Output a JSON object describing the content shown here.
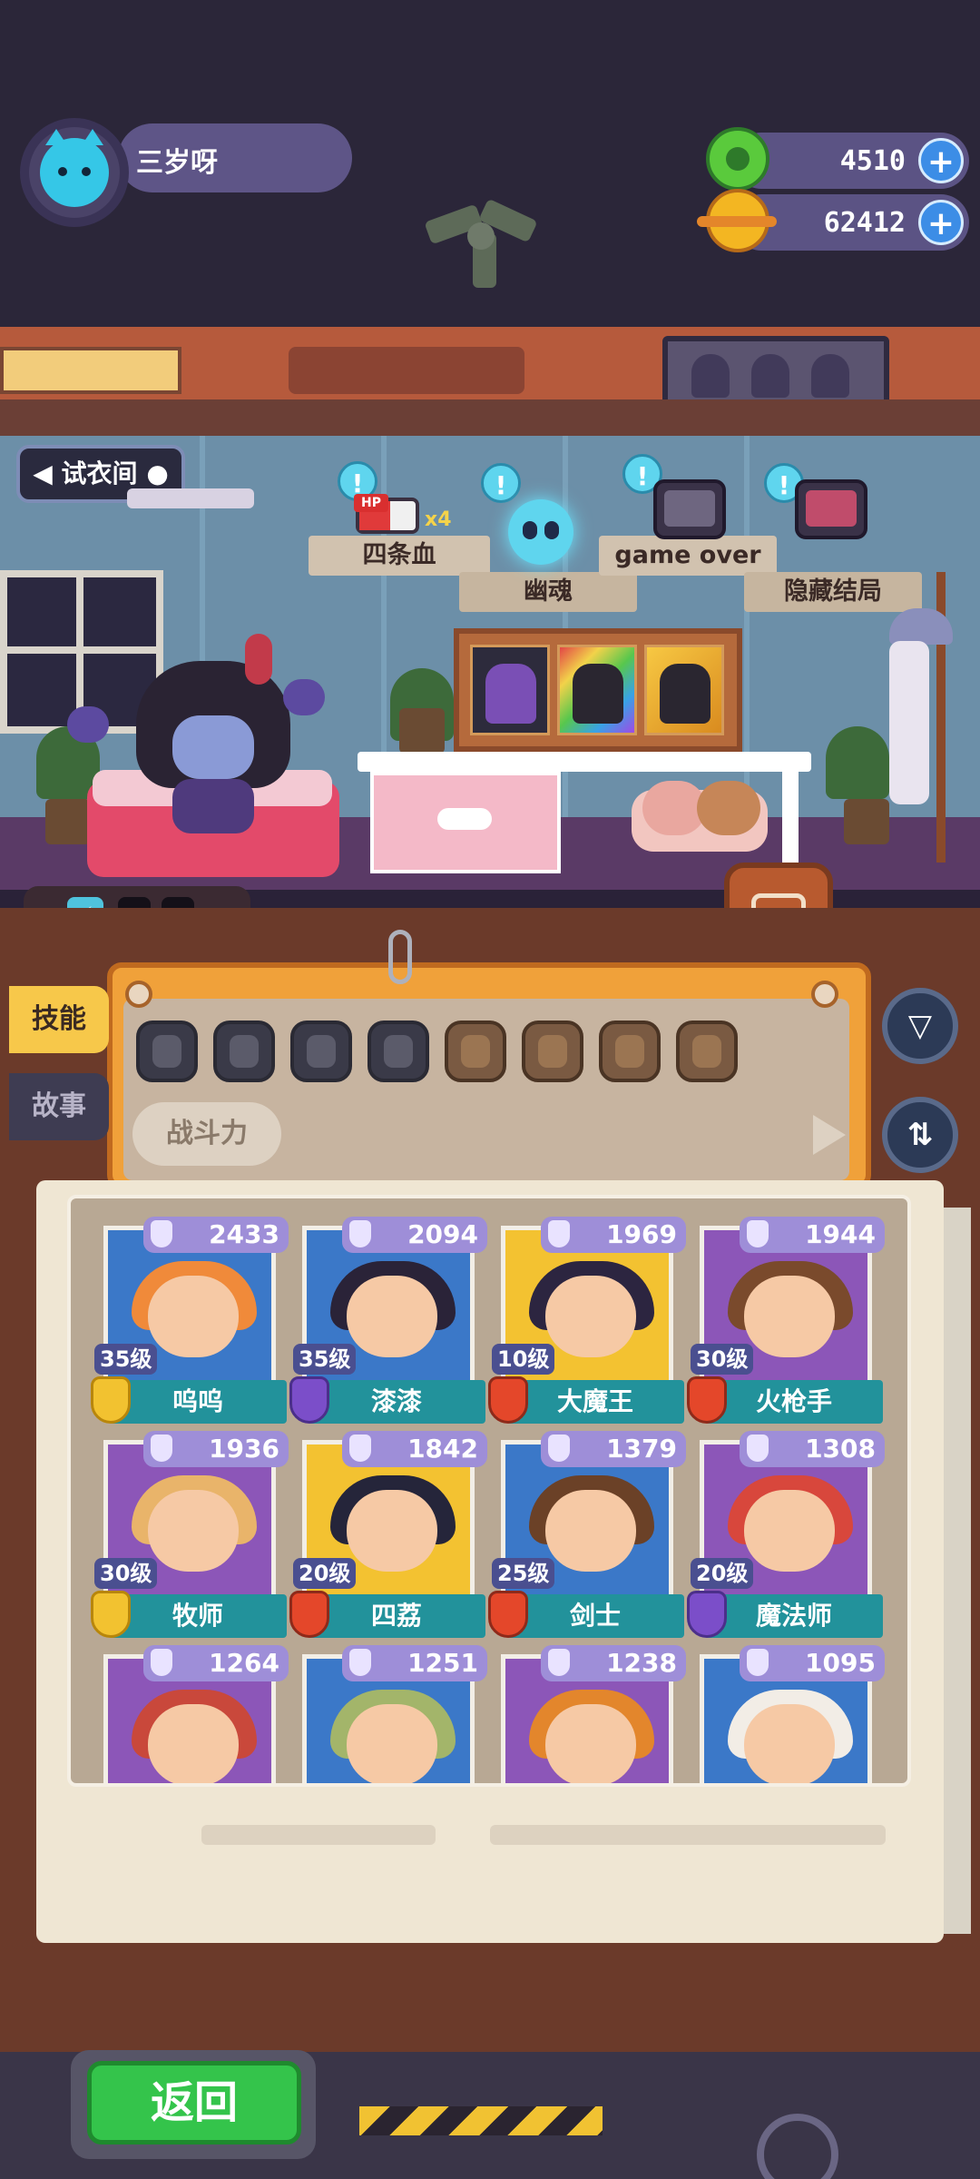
{
  "player": {
    "name": "三岁呀",
    "avatar_icon": "cat-face-icon"
  },
  "resources": [
    {
      "icon": "donut-icon",
      "value": "4510",
      "add_label": "+"
    },
    {
      "icon": "planet-icon",
      "value": "62412",
      "add_label": "+"
    }
  ],
  "room": {
    "fitting_room_label": "试衣间",
    "unlocks": [
      {
        "label": "四条血",
        "icon": "hp-battery-icon",
        "tag": "HP",
        "multiplier": "x4"
      },
      {
        "label": "幽魂",
        "icon": "ghost-skull-icon"
      },
      {
        "label": "game over",
        "icon": "tombstone-tv-icon"
      },
      {
        "label": "隐藏结局",
        "icon": "tv-icon"
      }
    ],
    "hint_label": "!"
  },
  "energy": {
    "icon": "lightning-icon",
    "bolt_label": "⚡"
  },
  "side_tabs": {
    "skills": "技能",
    "story": "故事"
  },
  "filter": {
    "sort_label": "战斗力",
    "filter_icon": "filter-funnel-icon",
    "sort_icon": "sort-arrows-icon"
  },
  "attributes": [
    {
      "icon": "heart-icon",
      "unlocked": false
    },
    {
      "icon": "bell-icon",
      "unlocked": false
    },
    {
      "icon": "shield-icon",
      "unlocked": false
    },
    {
      "icon": "anchor-icon",
      "unlocked": false
    },
    {
      "icon": "paw-icon",
      "unlocked": true
    },
    {
      "icon": "face-icon",
      "unlocked": true
    },
    {
      "icon": "muscle-icon",
      "unlocked": true
    },
    {
      "icon": "fingerprint-icon",
      "unlocked": true
    }
  ],
  "heroes": [
    {
      "power": "2433",
      "level": "35级",
      "name": "呜呜",
      "badge": "gold",
      "hair": "#f08a3a",
      "bg": "#3b78c8"
    },
    {
      "power": "2094",
      "level": "35级",
      "name": "漆漆",
      "badge": "purple",
      "hair": "#2a2338",
      "bg": "#3b78c8"
    },
    {
      "power": "1969",
      "level": "10级",
      "name": "大魔王",
      "badge": "red",
      "hair": "#2c2540",
      "bg": "#f3c231"
    },
    {
      "power": "1944",
      "level": "30级",
      "name": "火枪手",
      "badge": "red",
      "hair": "#7a4a2c",
      "bg": "#8c56b8"
    },
    {
      "power": "1936",
      "level": "30级",
      "name": "牧师",
      "badge": "gold",
      "hair": "#e9b46a",
      "bg": "#8c56b8"
    },
    {
      "power": "1842",
      "level": "20级",
      "name": "四荔",
      "badge": "red",
      "hair": "#25253a",
      "bg": "#f3c231"
    },
    {
      "power": "1379",
      "level": "25级",
      "name": "剑士",
      "badge": "red",
      "hair": "#6b4127",
      "bg": "#3b78c8"
    },
    {
      "power": "1308",
      "level": "20级",
      "name": "魔法师",
      "badge": "purple",
      "hair": "#d8473c",
      "bg": "#8c56b8"
    },
    {
      "power": "1264",
      "level": "",
      "name": "",
      "badge": "",
      "hair": "#c9483b",
      "bg": "#8c56b8"
    },
    {
      "power": "1251",
      "level": "",
      "name": "",
      "badge": "",
      "hair": "#a3b56a",
      "bg": "#3b78c8"
    },
    {
      "power": "1238",
      "level": "",
      "name": "",
      "badge": "",
      "hair": "#e3862c",
      "bg": "#8c56b8"
    },
    {
      "power": "1095",
      "level": "",
      "name": "",
      "badge": "",
      "hair": "#f2ede6",
      "bg": "#3b78c8"
    }
  ],
  "back_button": "返回",
  "colors": {
    "accent": "#f0a13a",
    "back_green": "#34c44b",
    "name_teal": "#22929b"
  }
}
